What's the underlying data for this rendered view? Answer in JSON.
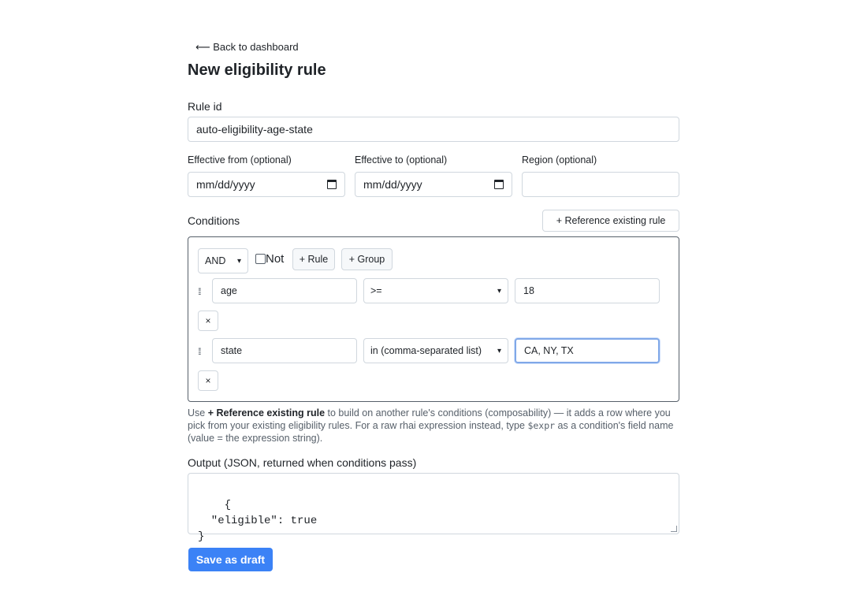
{
  "nav": {
    "back_label": "⟵ Back to dashboard"
  },
  "page": {
    "title": "New eligibility rule"
  },
  "rule_id": {
    "label": "Rule id",
    "value": "auto-eligibility-age-state"
  },
  "effective_from": {
    "label": "Effective from (optional)",
    "placeholder": "mm/dd/yyyy"
  },
  "effective_to": {
    "label": "Effective to (optional)",
    "placeholder": "mm/dd/yyyy"
  },
  "region": {
    "label": "Region (optional)",
    "value": ""
  },
  "conditions": {
    "label": "Conditions",
    "reference_button": "+ Reference existing rule",
    "combinator": "AND",
    "not_label": "Not",
    "not_checked": false,
    "add_rule_button": "+ Rule",
    "add_group_button": "+ Group",
    "rows": [
      {
        "field": "age",
        "operator": ">=",
        "value": "18",
        "remove": "×"
      },
      {
        "field": "state",
        "operator": "in (comma-separated list)",
        "value": "CA, NY, TX",
        "remove": "×"
      }
    ]
  },
  "help": {
    "pre": "Use ",
    "bold": "+ Reference existing rule",
    "mid": " to build on another rule's conditions (composability) — it adds a row where you pick from your existing eligibility rules. For a raw rhai expression instead, type ",
    "code": "$expr",
    "post": " as a condition's field name (value = the expression string)."
  },
  "output": {
    "label": "Output (JSON, returned when conditions pass)",
    "value": "{\n  \"eligible\": true\n}"
  },
  "save_button": "Save as draft",
  "colors": {
    "primary": "#3b82f6",
    "border": "#d0d7de",
    "focus": "#80a8e8"
  }
}
